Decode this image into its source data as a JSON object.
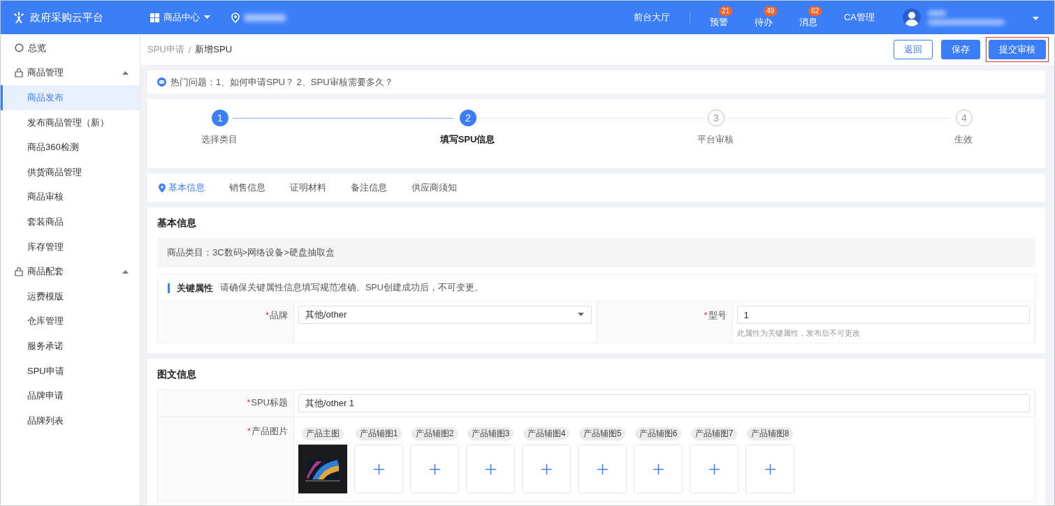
{
  "top_bar": {
    "logo": "政府采购云平台",
    "module": "商品中心",
    "hall": "前台大厅",
    "notices": [
      {
        "label": "预警",
        "count": "21"
      },
      {
        "label": "待办",
        "count": "49"
      },
      {
        "label": "消息",
        "count": "62"
      }
    ],
    "admin": "CA管理"
  },
  "sidebar": {
    "items": [
      {
        "label": "总览",
        "kind": "link",
        "selected": false
      },
      {
        "label": "商品管理",
        "kind": "group",
        "expanded": true,
        "children": [
          {
            "label": "商品发布",
            "selected": true
          },
          {
            "label": "发布商品管理（新）",
            "selected": false
          },
          {
            "label": "商品360检测",
            "selected": false
          },
          {
            "label": "供货商品管理",
            "selected": false
          },
          {
            "label": "商品审核",
            "selected": false
          },
          {
            "label": "套装商品",
            "selected": false
          },
          {
            "label": "库存管理",
            "selected": false
          }
        ]
      },
      {
        "label": "商品配套",
        "kind": "group",
        "expanded": true,
        "children": [
          {
            "label": "运费模版",
            "selected": false
          },
          {
            "label": "仓库管理",
            "selected": false
          },
          {
            "label": "服务承诺",
            "selected": false
          },
          {
            "label": "SPU申请",
            "selected": false
          },
          {
            "label": "品牌申请",
            "selected": false
          },
          {
            "label": "品牌列表",
            "selected": false
          }
        ]
      }
    ]
  },
  "breadcrumb": {
    "items": [
      "SPU申请",
      "新增SPU"
    ],
    "separator": "/"
  },
  "actions": [
    {
      "label": "返回",
      "kind": "outline",
      "highlighted": false
    },
    {
      "label": "保存",
      "kind": "primary",
      "highlighted": false
    },
    {
      "label": "提交审核",
      "kind": "primary",
      "highlighted": true
    }
  ],
  "hot_questions": "热门问题：1、如何申请SPU？ 2、SPU审核需要多久？",
  "steps": [
    {
      "number": "1",
      "label": "选择类目",
      "reached": true,
      "current": false
    },
    {
      "number": "2",
      "label": "填写SPU信息",
      "reached": true,
      "current": true
    },
    {
      "number": "3",
      "label": "平台审核",
      "reached": false,
      "current": false
    },
    {
      "number": "4",
      "label": "生效",
      "reached": false,
      "current": false
    }
  ],
  "tabs": [
    {
      "label": "基本信息",
      "selected": true
    },
    {
      "label": "销售信息",
      "selected": false
    },
    {
      "label": "证明材料",
      "selected": false
    },
    {
      "label": "备注信息",
      "selected": false
    },
    {
      "label": "供应商须知",
      "selected": false
    }
  ],
  "basic_info": {
    "title": "基本信息",
    "category": "商品类目：3C数码>网络设备>硬盘抽取盒",
    "key_title": "关键属性",
    "key_note": "请确保关键属性信息填写规范准确。SPU创建成功后，不可变更。",
    "fields": [
      {
        "mark": "*",
        "label": "品牌",
        "kind": "select",
        "value": "其他/other"
      },
      {
        "mark": "*",
        "label": "型号",
        "kind": "input",
        "value": "1",
        "hint": "此属性为关键属性，发布后不可更改"
      }
    ]
  },
  "media_info": {
    "title": "图文信息",
    "spu_title": {
      "mark": "*",
      "label": "SPU标题",
      "value": "其他/other 1"
    },
    "images": {
      "mark": "*",
      "label": "产品图片",
      "slots": [
        {
          "label": "产品主图",
          "kind": "picture"
        },
        {
          "label": "产品辅图1",
          "kind": "empty"
        },
        {
          "label": "产品辅图2",
          "kind": "empty"
        },
        {
          "label": "产品辅图3",
          "kind": "empty"
        },
        {
          "label": "产品辅图4",
          "kind": "empty"
        },
        {
          "label": "产品辅图5",
          "kind": "empty"
        },
        {
          "label": "产品辅图6",
          "kind": "empty"
        },
        {
          "label": "产品辅图7",
          "kind": "empty"
        },
        {
          "label": "产品辅图8",
          "kind": "empty"
        }
      ]
    }
  }
}
